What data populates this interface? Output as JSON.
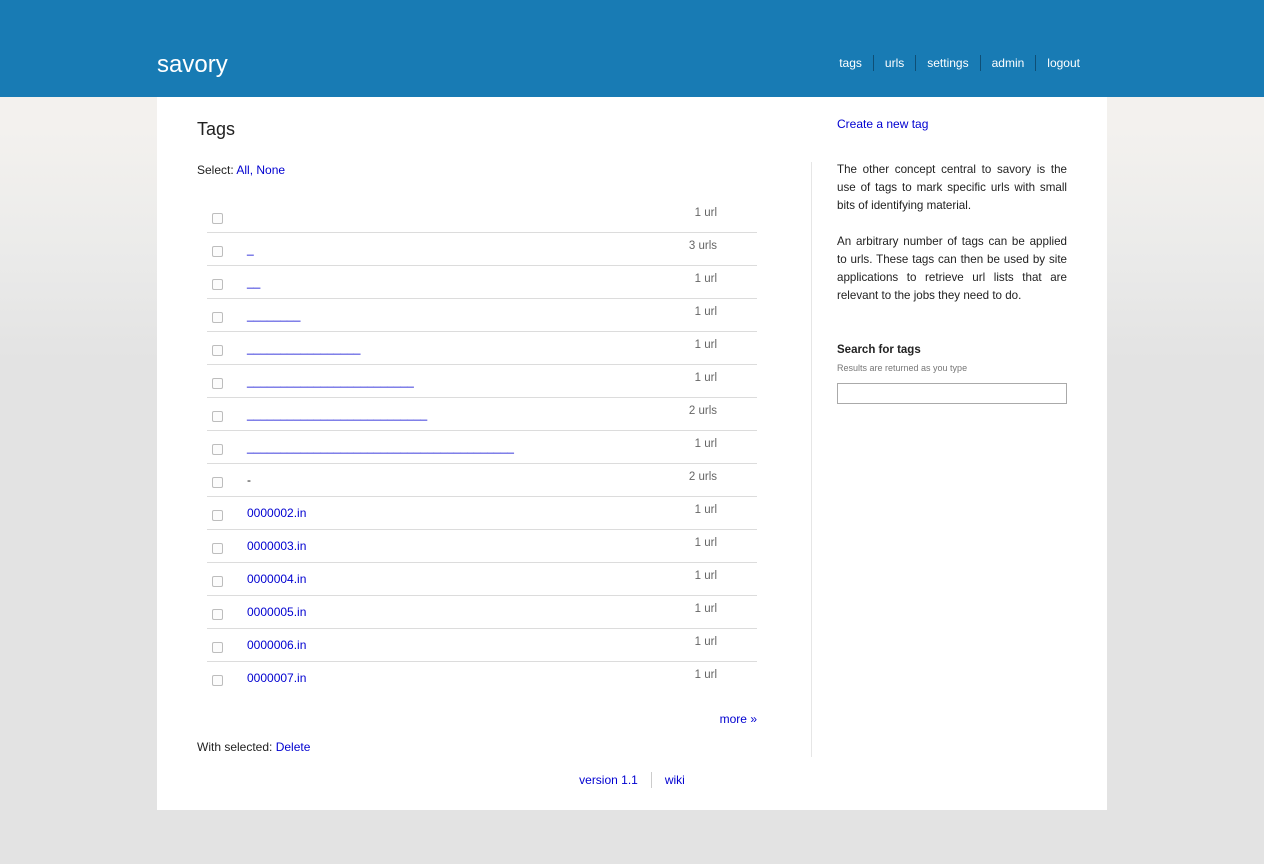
{
  "header": {
    "brand": "savory",
    "nav": [
      "tags",
      "urls",
      "settings",
      "admin",
      "logout"
    ]
  },
  "main": {
    "title": "Tags",
    "select_label": "Select:",
    "select_all": "All,",
    "select_none": "None",
    "tags": [
      {
        "name": "",
        "count": "1 url"
      },
      {
        "name": "_",
        "count": "3 urls"
      },
      {
        "name": "__",
        "count": "1 url"
      },
      {
        "name": "________",
        "count": "1 url"
      },
      {
        "name": "_________________",
        "count": "1 url"
      },
      {
        "name": "_________________________",
        "count": "1 url"
      },
      {
        "name": "___________________________",
        "count": "2 urls"
      },
      {
        "name": "________________________________________",
        "count": "1 url"
      },
      {
        "name": "-",
        "count": "2 urls"
      },
      {
        "name": "0000002.in",
        "count": "1 url"
      },
      {
        "name": "0000003.in",
        "count": "1 url"
      },
      {
        "name": "0000004.in",
        "count": "1 url"
      },
      {
        "name": "0000005.in",
        "count": "1 url"
      },
      {
        "name": "0000006.in",
        "count": "1 url"
      },
      {
        "name": "0000007.in",
        "count": "1 url"
      }
    ],
    "more": "more »",
    "with_selected_label": "With selected:",
    "delete": "Delete"
  },
  "sidebar": {
    "create_link": "Create a new tag",
    "about_p1": "The other concept central to savory is the use of tags to mark specific urls with small bits of identifying material.",
    "about_p2": "An arbitrary number of tags can be applied to urls. These tags can then be used by site applications to retrieve url lists that are relevant to the jobs they need to do.",
    "search_title": "Search for tags",
    "search_hint": "Results are returned as you type",
    "search_value": ""
  },
  "footer": {
    "version": "version 1.1",
    "wiki": "wiki"
  },
  "colors": {
    "header_bg": "#187bb4",
    "link": "#0000d0"
  }
}
